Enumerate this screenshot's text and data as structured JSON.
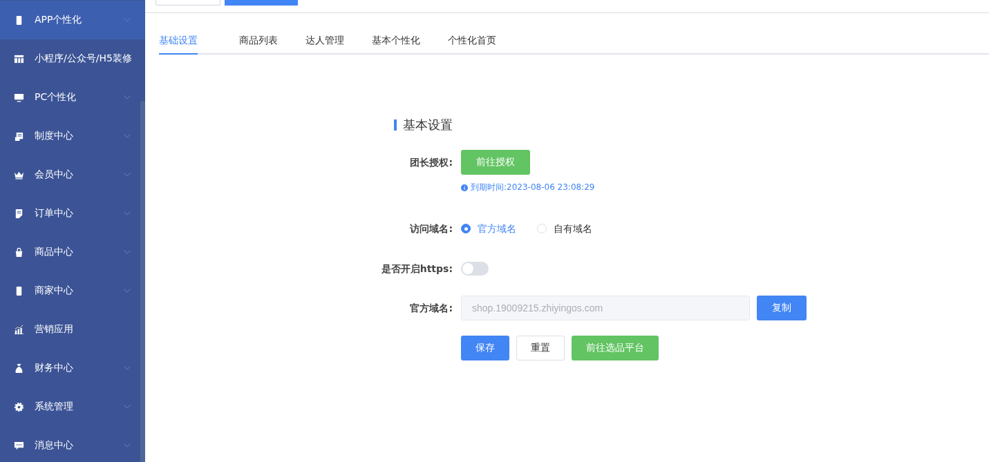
{
  "sidebar": {
    "items": [
      {
        "label": "APP个性化",
        "expandable": true,
        "selected": true
      },
      {
        "label": "小程序/公众号/H5装修",
        "expandable": false,
        "selected": false
      },
      {
        "label": "PC个性化",
        "expandable": true,
        "selected": false
      },
      {
        "label": "制度中心",
        "expandable": true,
        "selected": false
      },
      {
        "label": "会员中心",
        "expandable": true,
        "selected": false
      },
      {
        "label": "订单中心",
        "expandable": true,
        "selected": false
      },
      {
        "label": "商品中心",
        "expandable": true,
        "selected": false
      },
      {
        "label": "商家中心",
        "expandable": true,
        "selected": false
      },
      {
        "label": "营销应用",
        "expandable": false,
        "selected": false
      },
      {
        "label": "财务中心",
        "expandable": true,
        "selected": false
      },
      {
        "label": "系统管理",
        "expandable": true,
        "selected": false
      },
      {
        "label": "消息中心",
        "expandable": true,
        "selected": false
      }
    ]
  },
  "top_buttons": [
    {
      "kind": "plain"
    },
    {
      "kind": "primary"
    }
  ],
  "tabs": [
    {
      "label": "基础设置",
      "selected": true
    },
    {
      "label": "商品列表",
      "selected": false
    },
    {
      "label": "达人管理",
      "selected": false
    },
    {
      "label": "基本个性化",
      "selected": false
    },
    {
      "label": "个性化首页",
      "selected": false
    }
  ],
  "section_title": "基本设置",
  "form": {
    "auth": {
      "label": "团长授权:",
      "button": "前往授权",
      "hint": "到期时间:2023-08-06 23:08:29"
    },
    "domain_choice": {
      "label": "访问域名:",
      "options": [
        {
          "label": "官方域名",
          "selected": true
        },
        {
          "label": "自有域名",
          "selected": false
        }
      ]
    },
    "https": {
      "label": "是否开启https:",
      "on": false
    },
    "domain": {
      "label": "官方域名:",
      "value": "shop.19009215.zhiyingos.com",
      "disabled": true,
      "button": "复制"
    },
    "actions": [
      {
        "label": "保存",
        "kind": "primary"
      },
      {
        "label": "重置",
        "kind": "plain"
      },
      {
        "label": "前往选品平台",
        "kind": "success"
      }
    ]
  }
}
